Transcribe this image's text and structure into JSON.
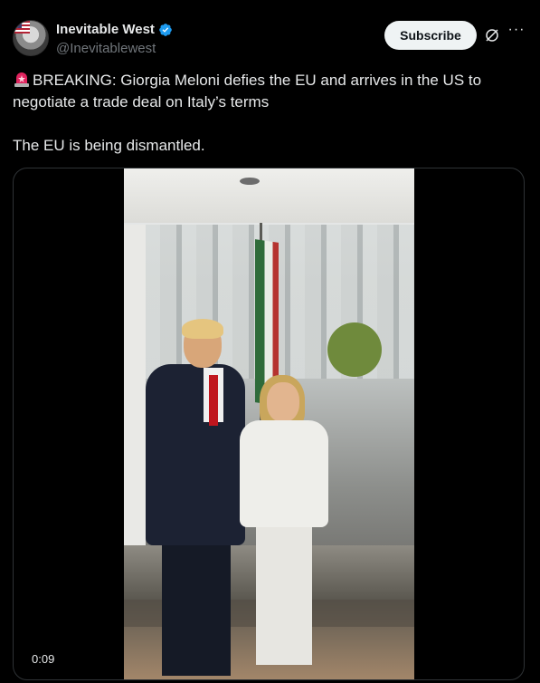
{
  "author": {
    "display_name": "Inevitable West",
    "handle": "@Inevitablewest",
    "verified": true,
    "avatar_icon": "avatar-image"
  },
  "actions": {
    "subscribe_label": "Subscribe",
    "grok_icon": "grok-icon",
    "more_icon": "more-icon"
  },
  "tweet": {
    "emoji_icon": "siren-emoji-icon",
    "line1": "BREAKING: Giorgia Meloni defies the EU and arrives in the US to negotiate a trade deal on Italy’s terms",
    "line2": "The EU is being dismantled."
  },
  "media": {
    "duration": "0:09"
  },
  "colors": {
    "background": "#000000",
    "text": "#e7e9ea",
    "secondary_text": "#71767b",
    "verified_blue": "#1d9bf0",
    "subscribe_bg": "#eff3f4",
    "border": "#2f3336"
  }
}
